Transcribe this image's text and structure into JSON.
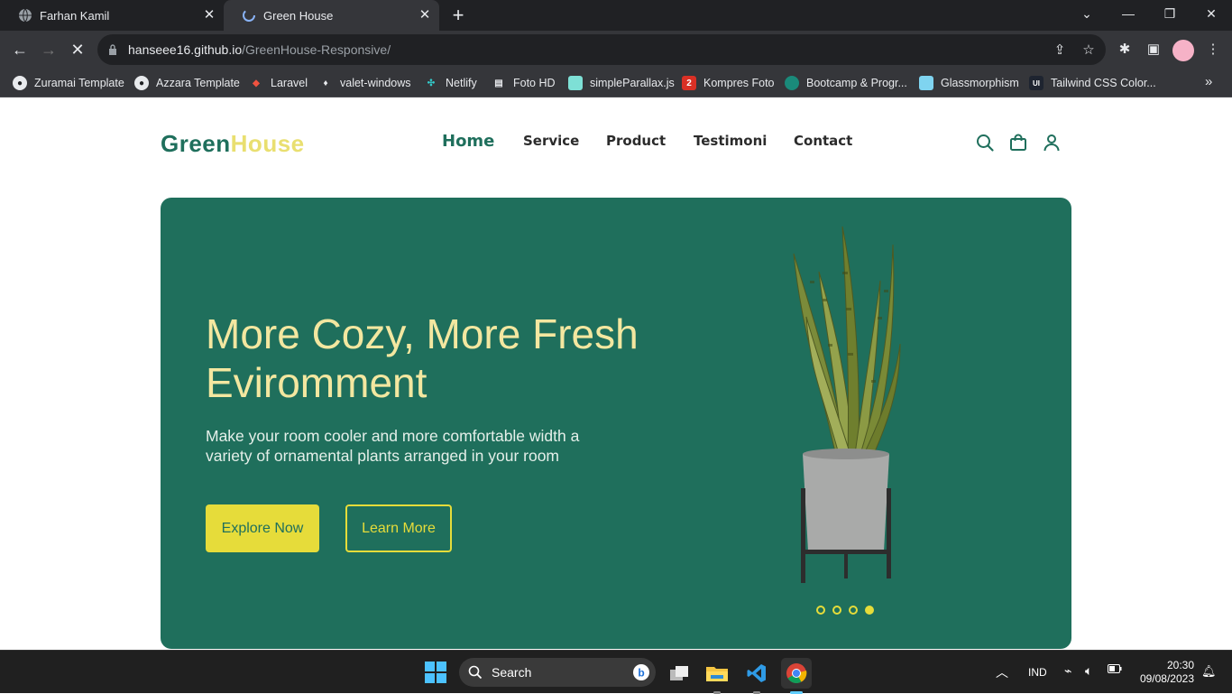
{
  "browser": {
    "tabs": [
      {
        "title": "Farhan Kamil",
        "active": false
      },
      {
        "title": "Green House",
        "active": true
      }
    ],
    "url_host": "hanseee16.github.io",
    "url_path": "/GreenHouse-Responsive/",
    "bookmarks": [
      "Zuramai Template",
      "Azzara Template",
      "Laravel",
      "valet-windows",
      "Netlify",
      "Foto HD",
      "simpleParallax.js",
      "Kompres Foto",
      "Bootcamp & Progr...",
      "Glassmorphism",
      "Tailwind CSS Color..."
    ]
  },
  "site": {
    "logo_part1": "Green",
    "logo_part2": "House",
    "nav": [
      "Home",
      "Service",
      "Product",
      "Testimoni",
      "Contact"
    ],
    "active_nav": "Home",
    "hero": {
      "title_line1": "More Cozy, More Fresh",
      "title_line2": "Eviromment",
      "subtitle_line1": "Make your room cooler and more comfortable width a",
      "subtitle_line2": "variety of ornamental plants arranged in your room",
      "primary_button": "Explore Now",
      "secondary_button": "Learn More",
      "slides_total": 4,
      "active_slide": 4
    },
    "colors": {
      "brand_green": "#1f6f5c",
      "accent_yellow": "#e6dc3a",
      "title_cream": "#f3e7a0"
    }
  },
  "taskbar": {
    "search_label": "Search",
    "language": "IND",
    "time": "20:30",
    "date": "09/08/2023"
  }
}
